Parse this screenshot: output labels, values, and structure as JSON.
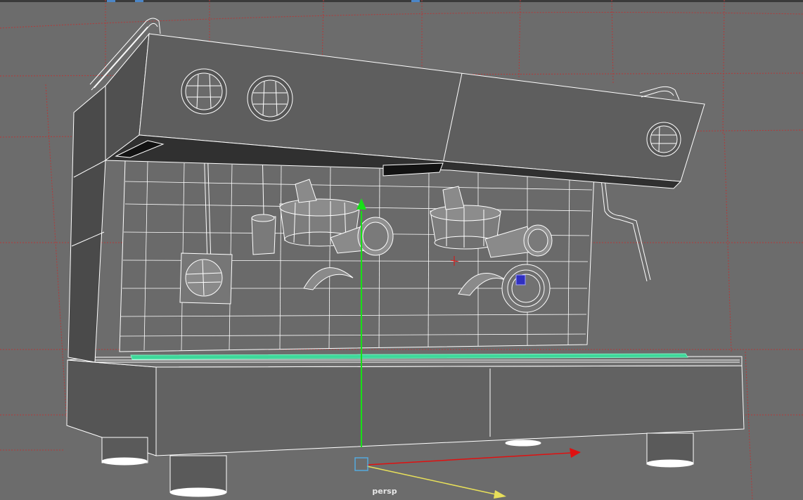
{
  "viewport": {
    "camera_label": "persp",
    "background_color": "#6c6c6c",
    "grid_color": "#b23a3a",
    "wire_color": "#ffffff",
    "selected_color": "#3ed89a",
    "axis_colors": {
      "x": "#e01010",
      "y": "#18e018",
      "z": "#e8e05a"
    }
  },
  "scene": {
    "object": "espresso-machine-wireframe",
    "manipulator": "move-tool"
  }
}
